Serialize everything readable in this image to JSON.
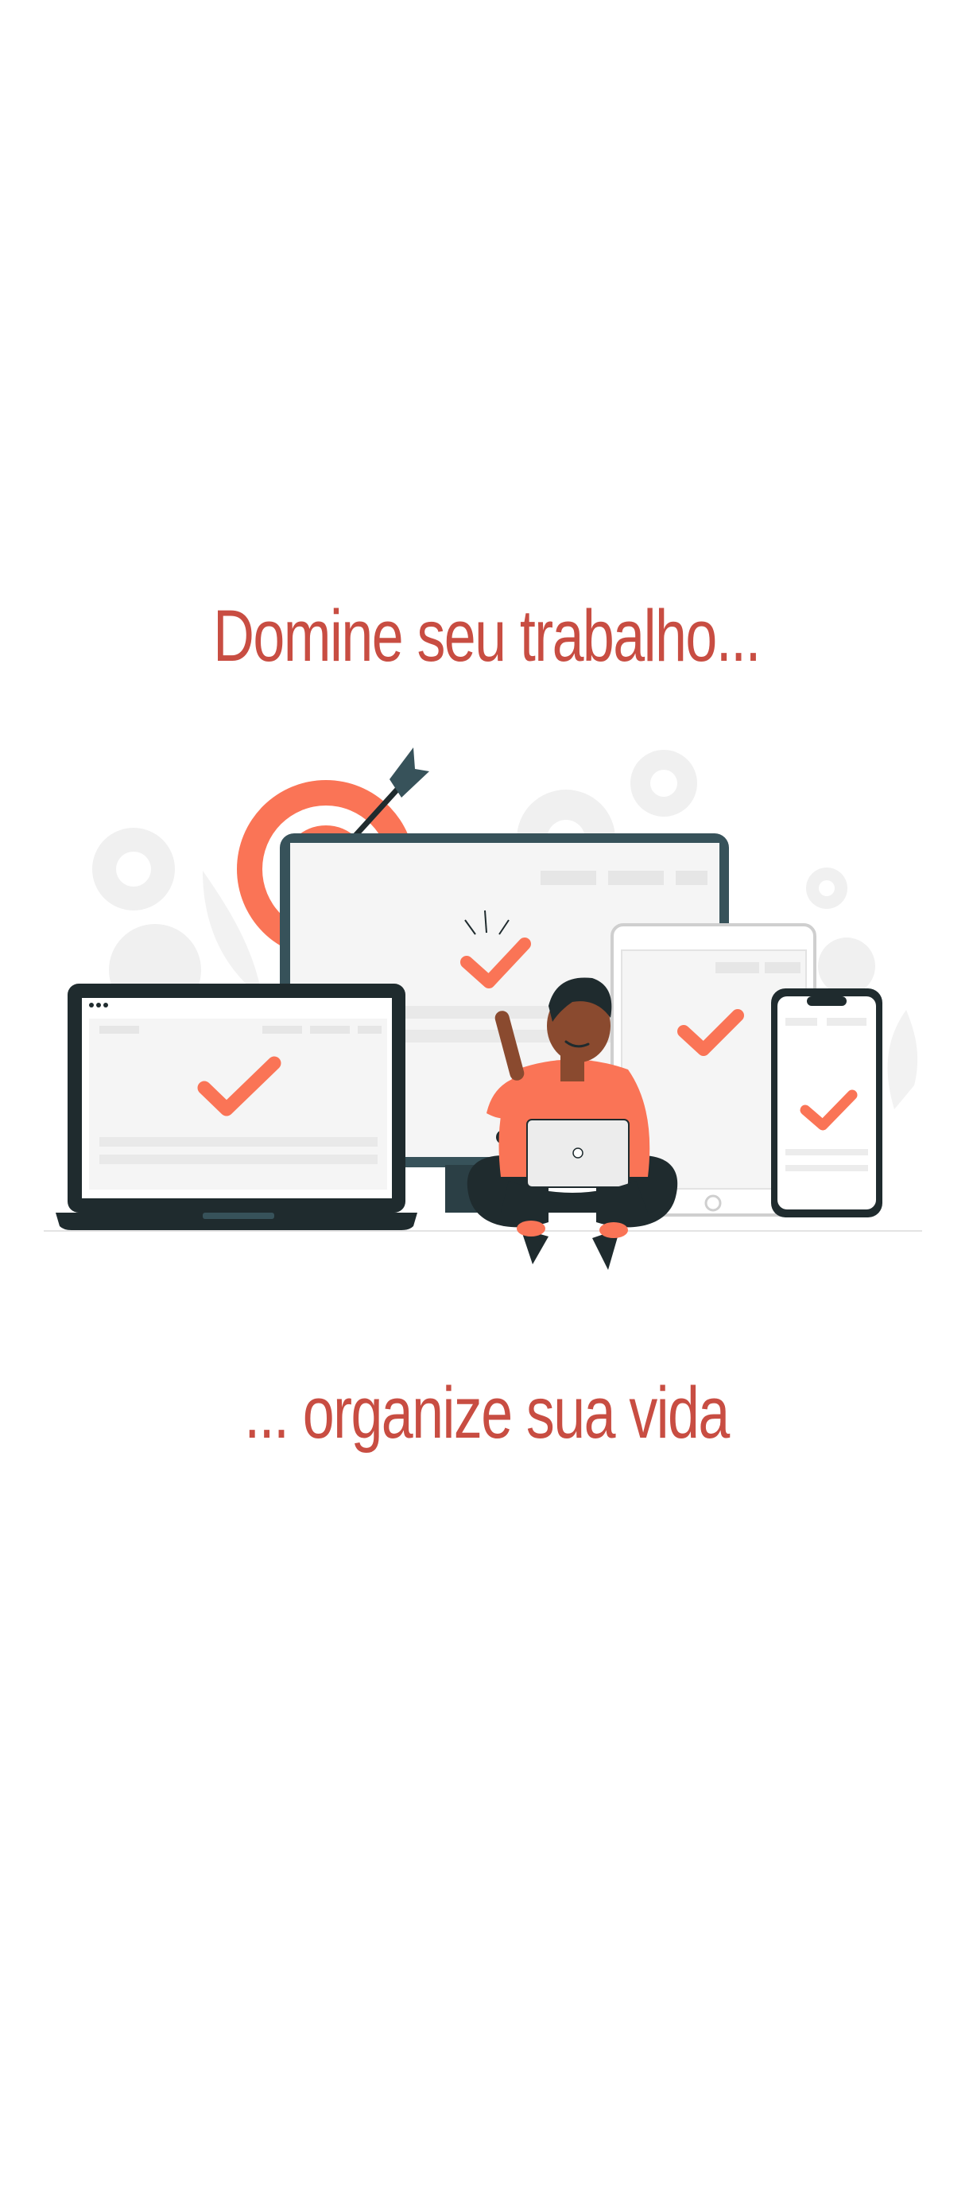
{
  "onboarding": {
    "title_top": "Domine seu trabalho...",
    "title_bottom": "... organize sua vida"
  },
  "illustration": {
    "name": "productivity-devices-illustration",
    "icons": [
      "target-icon",
      "arrow-icon",
      "checkmark-icon",
      "gear-icon",
      "laptop-icon",
      "monitor-icon",
      "tablet-icon",
      "smartphone-icon",
      "person-icon"
    ]
  },
  "colors": {
    "headline": "#c84d42",
    "accent": "#fa7456",
    "dark": "#1f2b2e",
    "monitor_stand": "#37525a",
    "light_gray": "#ececec",
    "pale_gray": "#f5f5f5",
    "skin": "#8a4a2f"
  }
}
